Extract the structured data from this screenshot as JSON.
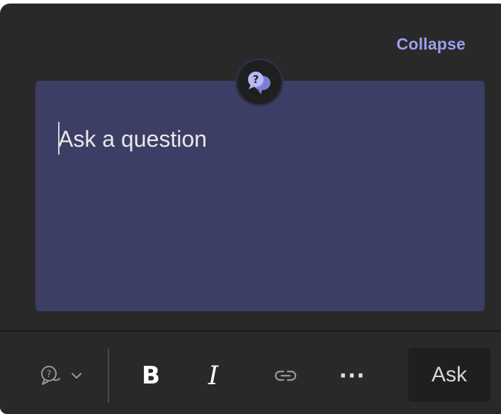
{
  "header": {
    "collapse_label": "Collapse"
  },
  "composer": {
    "placeholder": "Ask a question",
    "badge_icon": "question-chat-icon"
  },
  "toolbar": {
    "type_selector_icon": "question-bubble-icon",
    "type_selector_chevron": "chevron-down-icon",
    "bold_label": "B",
    "italic_label": "I",
    "link_icon": "link-icon",
    "more_label": "···",
    "ask_label": "Ask"
  },
  "colors": {
    "panel_background": "#292929",
    "input_background": "#3d3e66",
    "accent": "#9c9ff1",
    "ask_button_background": "#1f1f1f"
  }
}
